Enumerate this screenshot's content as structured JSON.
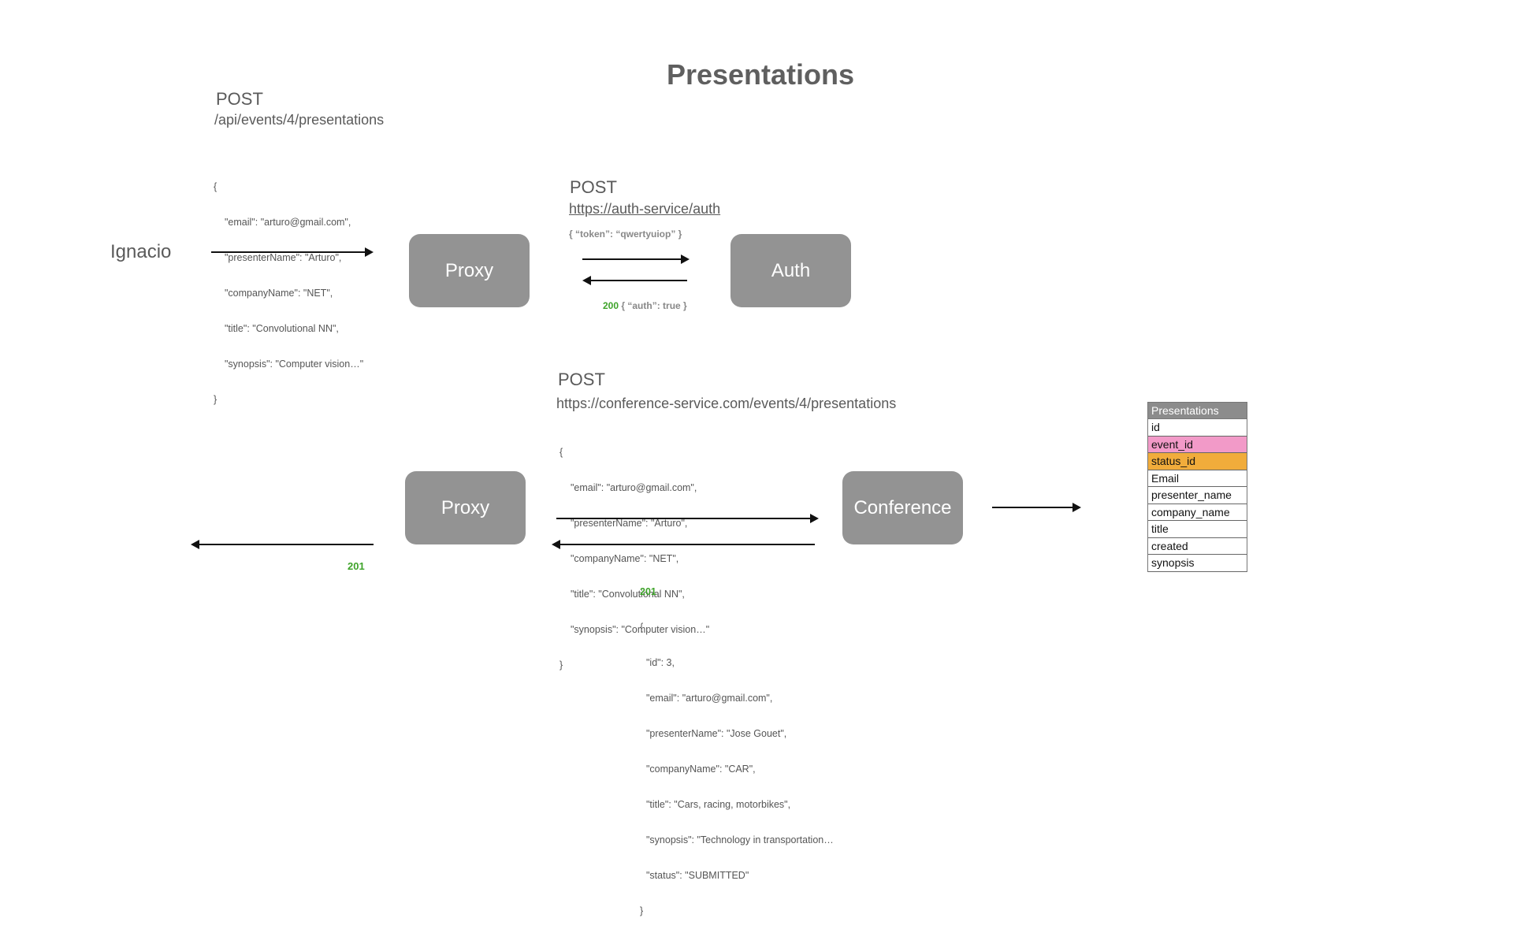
{
  "title": "Presentations",
  "actor": "Ignacio",
  "request1": {
    "method": "POST",
    "url": "/api/events/4/presentations",
    "body": {
      "open": "{",
      "lines": [
        "\"email\": \"arturo@gmail.com\",",
        "\"presenterName\": \"Arturo\",",
        "\"companyName\": \"NET\",",
        "\"title\": \"Convolutional NN\",",
        "\"synopsis\": \"Computer vision…\""
      ],
      "close": "}"
    }
  },
  "auth_request": {
    "method": "POST",
    "url": "https://auth-service/auth",
    "payload": "{ “token”: “qwertyuiop” }",
    "response_status": "200",
    "response_body": "{ “auth”: true }"
  },
  "boxes": {
    "proxy_top": "Proxy",
    "auth": "Auth",
    "proxy_bottom": "Proxy",
    "conference": "Conference"
  },
  "conference_request": {
    "method": "POST",
    "url": "https://conference-service.com/events/4/presentations",
    "body": {
      "open": "{",
      "lines": [
        "\"email\": \"arturo@gmail.com\",",
        "\"presenterName\": \"Arturo\",",
        "\"companyName\": \"NET\",",
        "\"title\": \"Convolutional NN\",",
        "\"synopsis\": \"Computer vision…\""
      ],
      "close": "}"
    }
  },
  "conference_response": {
    "status": "201",
    "open": "{",
    "lines": [
      "\"id\": 3,",
      "\"email\": \"arturo@gmail.com\",",
      "\"presenterName\": \"Jose Gouet\",",
      "\"companyName\": \"CAR\",",
      "\"title\": \"Cars, racing, motorbikes\",",
      "\"synopsis\": \"Technology in transportation…",
      "\"status\": \"SUBMITTED\""
    ],
    "close": "}"
  },
  "client_response_status": "201",
  "db_table": {
    "name": "Presentations",
    "columns": [
      {
        "name": "id",
        "highlight": "none"
      },
      {
        "name": "event_id",
        "highlight": "pink"
      },
      {
        "name": "status_id",
        "highlight": "orange"
      },
      {
        "name": "Email",
        "highlight": "none"
      },
      {
        "name": "presenter_name",
        "highlight": "none"
      },
      {
        "name": "company_name",
        "highlight": "none"
      },
      {
        "name": "title",
        "highlight": "none"
      },
      {
        "name": "created",
        "highlight": "none"
      },
      {
        "name": "synopsis",
        "highlight": "none"
      }
    ],
    "colors": {
      "pink": "#f29ac8",
      "orange": "#f1ac3b",
      "header": "#8c8c8c"
    }
  },
  "colors": {
    "box": "#939393",
    "status_green": "#3ea32a"
  }
}
